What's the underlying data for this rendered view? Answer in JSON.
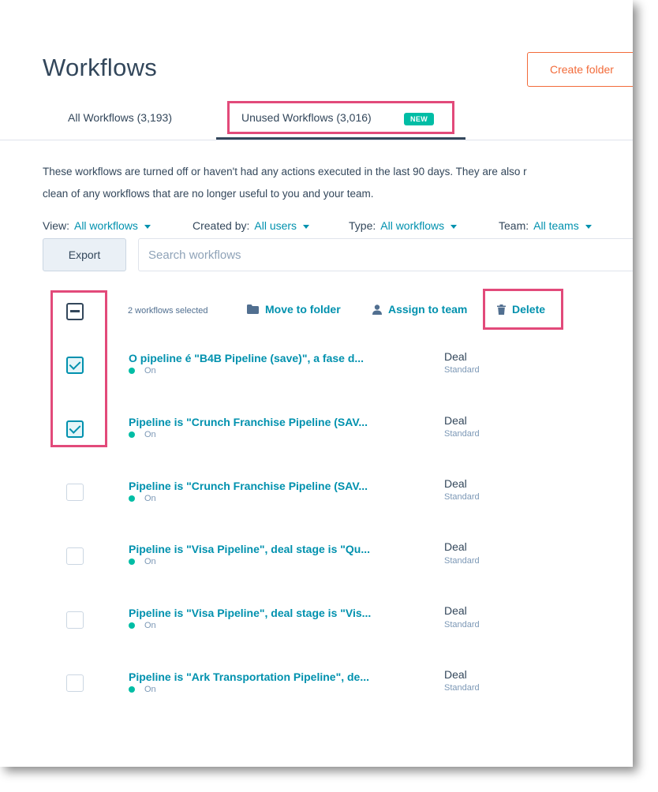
{
  "header": {
    "title": "Workflows",
    "create_folder_label": "Create folder"
  },
  "tabs": [
    {
      "label": "All Workflows (3,193)",
      "active": false
    },
    {
      "label": "Unused Workflows (3,016)",
      "active": true,
      "badge": "NEW"
    }
  ],
  "description": {
    "line1": "These workflows are turned off or haven't had any actions executed in the last 90 days. They are also r",
    "line2": "clean of any workflows that are no longer useful to you and your team."
  },
  "filters": [
    {
      "label": "View:",
      "value": "All workflows"
    },
    {
      "label": "Created by:",
      "value": "All users"
    },
    {
      "label": "Type:",
      "value": "All workflows"
    },
    {
      "label": "Team:",
      "value": "All teams"
    }
  ],
  "toolbar": {
    "export_label": "Export",
    "search_placeholder": "Search workflows"
  },
  "bulk": {
    "selected_text": "2 workflows selected",
    "move_label": "Move to folder",
    "assign_label": "Assign to team",
    "delete_label": "Delete"
  },
  "rows": [
    {
      "title": "O pipeline é \"B4B Pipeline (save)\", a fase d...",
      "status": "On",
      "type": "Deal",
      "subtype": "Standard",
      "checked": true
    },
    {
      "title": "Pipeline is \"Crunch Franchise Pipeline (SAV...",
      "status": "On",
      "type": "Deal",
      "subtype": "Standard",
      "checked": true
    },
    {
      "title": "Pipeline is \"Crunch Franchise Pipeline (SAV...",
      "status": "On",
      "type": "Deal",
      "subtype": "Standard",
      "checked": false
    },
    {
      "title": "Pipeline is \"Visa Pipeline\", deal stage is \"Qu...",
      "status": "On",
      "type": "Deal",
      "subtype": "Standard",
      "checked": false
    },
    {
      "title": "Pipeline is \"Visa Pipeline\", deal stage is \"Vis...",
      "status": "On",
      "type": "Deal",
      "subtype": "Standard",
      "checked": false
    },
    {
      "title": "Pipeline is \"Ark Transportation Pipeline\", de...",
      "status": "On",
      "type": "Deal",
      "subtype": "Standard",
      "checked": false
    }
  ],
  "colors": {
    "accent": "#0091ae",
    "brand_orange": "#f26b3a",
    "status_on": "#00bda5",
    "highlight": "#e24a7a",
    "text": "#33475b"
  }
}
